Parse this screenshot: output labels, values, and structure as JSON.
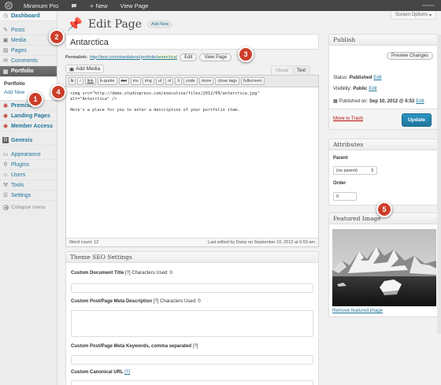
{
  "adminbar": {
    "site_name": "Minimum Pro",
    "new_label": "New",
    "view_page": "View Page",
    "screen_options": "Screen Options"
  },
  "sidebar": {
    "items": [
      {
        "label": "Dashboard",
        "icon": "dashboard-icon"
      },
      {
        "label": "Posts",
        "icon": "pin-icon"
      },
      {
        "label": "Media",
        "icon": "media-icon"
      },
      {
        "label": "Pages",
        "icon": "pages-icon"
      },
      {
        "label": "Comments",
        "icon": "comment-icon"
      },
      {
        "label": "Portfolio",
        "icon": "portfolio-icon"
      },
      {
        "label": "Premise",
        "icon": "premise-icon"
      },
      {
        "label": "Landing Pages",
        "icon": "landing-icon"
      },
      {
        "label": "Member Access",
        "icon": "member-icon"
      },
      {
        "label": "Genesis",
        "icon": "genesis-icon"
      },
      {
        "label": "Appearance",
        "icon": "appearance-icon"
      },
      {
        "label": "Plugins",
        "icon": "plugin-icon"
      },
      {
        "label": "Users",
        "icon": "users-icon"
      },
      {
        "label": "Tools",
        "icon": "tools-icon"
      },
      {
        "label": "Settings",
        "icon": "settings-icon"
      }
    ],
    "submenu_head": "Portfolio",
    "submenu_add": "Add New",
    "collapse": "Collapse menu"
  },
  "page": {
    "title": "Edit Page",
    "add_new": "Add New",
    "post_title": "Antarctica",
    "permalink_label": "Permalink:",
    "permalink_base": "http://test.com/standalone/portfolio/",
    "permalink_slug": "antarctica",
    "permalink_end": "/",
    "edit_btn": "Edit",
    "view_btn": "View Page",
    "add_media": "Add Media",
    "tab_visual": "Visual",
    "tab_text": "Text"
  },
  "quicktags": [
    "b",
    "i",
    "link",
    "b-quote",
    "del",
    "ins",
    "img",
    "ul",
    "ol",
    "li",
    "code",
    "more",
    "close tags",
    "fullscreen"
  ],
  "editor": {
    "content": "<img src=\"http://demo.studiopress.com/executive/files/2012/09/antarctica.jpg\"\nalt=\"Antarctica\" />\n\nHere's a place for you to enter a description of your portfolio item.",
    "word_count": "Word count: 12",
    "last_edited": "Last edited by Daisy on September 10, 2012 at 6:53 am"
  },
  "seo": {
    "title": "Theme SEO Settings",
    "doc_title_label": "Custom Document Title",
    "doc_title_note": "[?] Characters Used: 0",
    "meta_desc_label": "Custom Post/Page Meta Description",
    "meta_desc_note": "[?] Characters Used: 0",
    "keywords_label": "Custom Post/Page Meta Keywords, comma separated",
    "keywords_note": "[?]",
    "canonical_label": "Custom Canonical URL",
    "canonical_note": "[?]"
  },
  "publish": {
    "title": "Publish",
    "preview": "Preview Changes",
    "status_label": "Status:",
    "status_value": "Published",
    "visibility_label": "Visibility:",
    "visibility_value": "Public",
    "published_label": "Published on:",
    "published_value": "Sep 10, 2012 @ 6:53",
    "edit": "Edit",
    "trash": "Move to Trash",
    "update": "Update"
  },
  "attributes": {
    "title": "Attributes",
    "parent_label": "Parent",
    "parent_value": "(no parent)",
    "order_label": "Order",
    "order_value": "0"
  },
  "featured": {
    "title": "Featured Image",
    "remove": "Remove featured image"
  },
  "callouts": [
    "1",
    "2",
    "3",
    "4",
    "5"
  ],
  "colors": {
    "accent": "#21759b",
    "callout": "#cc3e29",
    "adminbar": "#464646"
  }
}
